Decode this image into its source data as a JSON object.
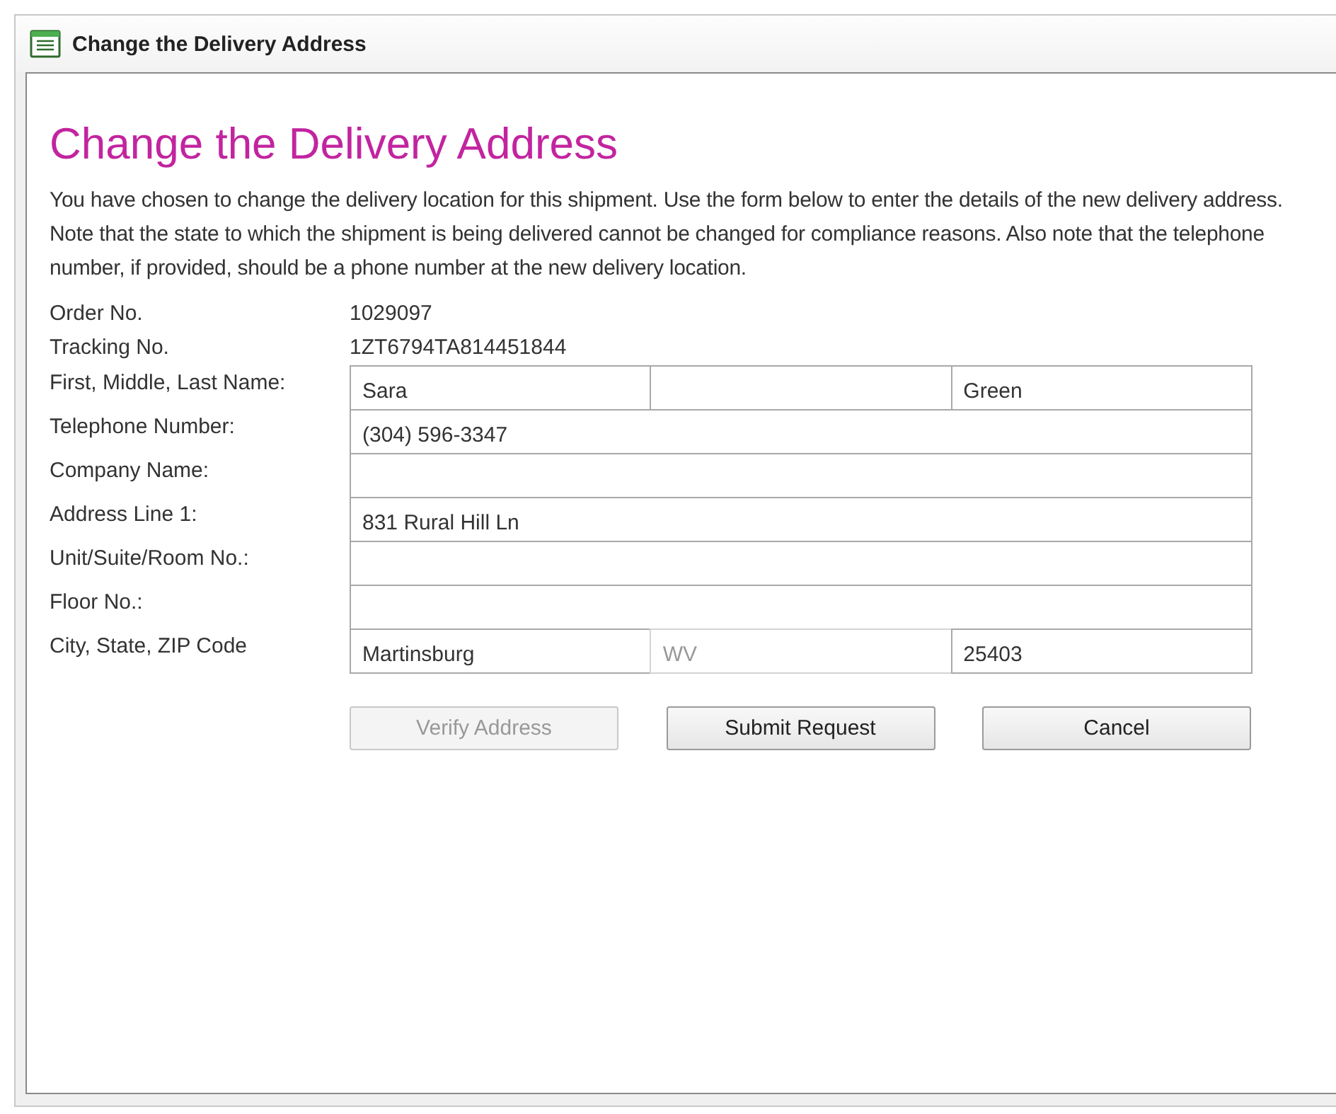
{
  "window": {
    "title": "Change the Delivery Address"
  },
  "heading": "Change the Delivery Address",
  "intro": "You have chosen to change the delivery location for this shipment. Use the form below to enter the details of the new delivery address. Note that the state to which the shipment is being delivered cannot be changed for compliance reasons. Also note that the telephone number, if provided, should be a phone number at the new delivery location.",
  "info": [
    {
      "label": "Order No.",
      "value": "1029097"
    },
    {
      "label": "Tracking No.",
      "value": "1ZT6794TA814451844"
    }
  ],
  "form": [
    {
      "label": "First, Middle, Last Name:",
      "fields": [
        {
          "value": "Sara",
          "disabled": false
        },
        {
          "disabled": false
        },
        {
          "value": "Green",
          "disabled": false
        }
      ]
    },
    {
      "label": "Telephone Number:",
      "fields": [
        {
          "value": "(304) 596-3347",
          "disabled": false
        }
      ]
    },
    {
      "label": "Company Name:",
      "fields": [
        {
          "disabled": false
        }
      ]
    },
    {
      "label": "Address Line 1:",
      "fields": [
        {
          "value": "831 Rural Hill Ln",
          "disabled": false
        }
      ]
    },
    {
      "label": "Unit/Suite/Room No.:",
      "fields": [
        {
          "disabled": false
        }
      ]
    },
    {
      "label": "Floor No.:",
      "fields": [
        {
          "disabled": false
        }
      ]
    },
    {
      "label": "City, State, ZIP Code",
      "fields": [
        {
          "value": "Martinsburg",
          "disabled": false
        },
        {
          "value": "WV",
          "disabled": true
        },
        {
          "value": "25403",
          "disabled": false
        }
      ]
    }
  ],
  "buttons": [
    {
      "label": "Verify Address",
      "disabled": true
    },
    {
      "label": "Submit Request",
      "disabled": false
    },
    {
      "label": "Cancel",
      "disabled": false
    }
  ]
}
